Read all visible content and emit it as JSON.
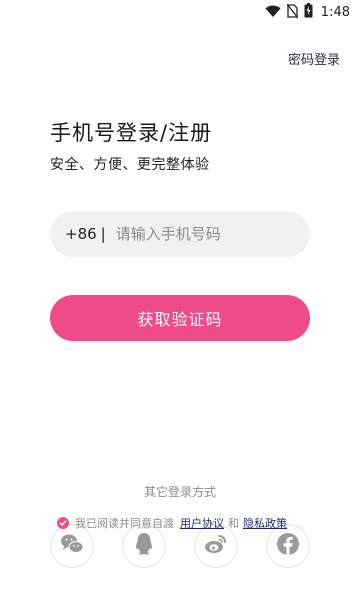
{
  "status_bar": {
    "time": "1:48",
    "icons": [
      "wifi-icon",
      "no-sim-icon",
      "battery-charging-icon"
    ]
  },
  "header": {
    "password_login_link": "密码登录"
  },
  "main": {
    "title": "手机号登录/注册",
    "subtitle": "安全、方便、更完整体验",
    "phone": {
      "country_code": "+86",
      "separator": "|",
      "value": "",
      "placeholder": "请输入手机号码"
    },
    "get_code_button": "获取验证码"
  },
  "footer": {
    "other_login_label": "其它登录方式",
    "social": [
      {
        "name": "wechat",
        "icon": "wechat-icon"
      },
      {
        "name": "qq",
        "icon": "qq-icon"
      },
      {
        "name": "weibo",
        "icon": "weibo-icon"
      },
      {
        "name": "facebook",
        "icon": "facebook-icon"
      }
    ],
    "agreement": {
      "checked": true,
      "prefix": "我已阅读并同意自渡",
      "user_agreement": "用户协议",
      "and": "和",
      "privacy_policy": "隐私政策"
    }
  },
  "colors": {
    "accent": "#ef4a8a",
    "link": "#1e2a6e",
    "input_bg": "#f1f1f1",
    "muted_text": "#8c8c8c"
  }
}
